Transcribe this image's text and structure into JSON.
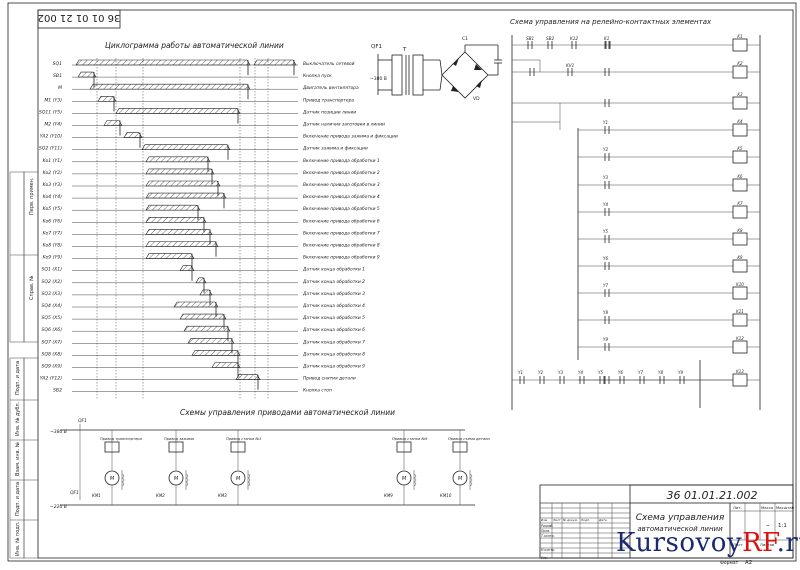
{
  "sheet": {
    "code_top": "36 01 01 21 002",
    "code_stamp": "36 01.01.21.002",
    "title_stamp_1": "Схема управления",
    "title_stamp_2": "автоматической линии",
    "watermark_a": "Kursovoy",
    "watermark_b": "RF",
    "watermark_c": ".ru",
    "format_label": "Формат",
    "format_value": "A2"
  },
  "cyclogram": {
    "title": "Циклограмма работы автоматической линии",
    "rows": [
      {
        "code": "SQ1",
        "label": "Выключатель сетевой"
      },
      {
        "code": "SB1",
        "label": "Кнопка пуск"
      },
      {
        "code": "M",
        "label": "Двигатель вентилятора"
      },
      {
        "code": "M1 (Y3)",
        "label": "Привод транспортера"
      },
      {
        "code": "SQ11 (Y5)",
        "label": "Датчик позиции линии"
      },
      {
        "code": "M2 (Y4)",
        "label": "Датчик наличия заготовки в линии"
      },
      {
        "code": "YA2 (Y10)",
        "label": "Включение привода зажима и фиксации"
      },
      {
        "code": "SQ2 (Y11)",
        "label": "Датчик зажима и фиксации"
      },
      {
        "code": "Ko1 (Y1)",
        "label": "Включение привода обработки 1"
      },
      {
        "code": "Ko2 (Y2)",
        "label": "Включение привода обработки 2"
      },
      {
        "code": "Ko3 (Y3)",
        "label": "Включение привода обработки 3"
      },
      {
        "code": "Ko4 (Y4)",
        "label": "Включение привода обработки 4"
      },
      {
        "code": "Ko5 (Y5)",
        "label": "Включение привода обработки 5"
      },
      {
        "code": "Ko6 (Y6)",
        "label": "Включение привода обработки 6"
      },
      {
        "code": "Ko7 (Y7)",
        "label": "Включение привода обработки 7"
      },
      {
        "code": "Ko8 (Y8)",
        "label": "Включение привода обработки 8"
      },
      {
        "code": "Ko9 (Y9)",
        "label": "Включение привода обработки 9"
      },
      {
        "code": "SQ1 (X1)",
        "label": "Датчик конца обработки 1"
      },
      {
        "code": "SQ2 (X2)",
        "label": "Датчик конца обработки 2"
      },
      {
        "code": "SQ3 (X3)",
        "label": "Датчик конца обработки 3"
      },
      {
        "code": "SQ4 (X4)",
        "label": "Датчик конца обработки 4"
      },
      {
        "code": "SQ5 (X5)",
        "label": "Датчик конца обработки 5"
      },
      {
        "code": "SQ6 (X6)",
        "label": "Датчик конца обработки 6"
      },
      {
        "code": "SQ7 (X7)",
        "label": "Датчик конца обработки 7"
      },
      {
        "code": "SQ8 (X8)",
        "label": "Датчик конца обработки 8"
      },
      {
        "code": "SQ9 (X9)",
        "label": "Датчик конца обработки 9"
      },
      {
        "code": "YA2 (Y12)",
        "label": "Привод снятия детали"
      },
      {
        "code": "SB2",
        "label": "Кнопка стоп"
      }
    ]
  },
  "relay_scheme": {
    "title": "Схема управления на релейно-контактных элементах",
    "relays": [
      "K1",
      "K2",
      "K3",
      "K4",
      "K5",
      "K6",
      "K7",
      "K8",
      "K9",
      "K10",
      "K11",
      "K12",
      "K13"
    ],
    "contacts": [
      "SB1",
      "SB2",
      "K12",
      "K1",
      "KV1",
      "Y1",
      "Y2",
      "Y3",
      "Y4",
      "Y5",
      "Y6",
      "Y7",
      "Y8",
      "Y9"
    ]
  },
  "power_scheme": {
    "title": "Схемы управления приводами автоматической линии",
    "labels": {
      "qf1": "QF1",
      "tr": "T",
      "vd": "VD",
      "c1": "C1",
      "bus_top": "~380 В",
      "bus_bottom": "~220 В"
    },
    "drives": [
      {
        "name": "Привод транспортера",
        "motor": "М",
        "contact": "КМ1"
      },
      {
        "name": "Привод зажима",
        "motor": "М",
        "contact": "КМ2"
      },
      {
        "name": "Привод станка №1",
        "motor": "М",
        "contact": "КМ3"
      },
      {
        "name": "Привод станка №9",
        "motor": "М",
        "contact": "КМ9"
      },
      {
        "name": "Привод съема детали",
        "motor": "М",
        "contact": "КМ10"
      }
    ]
  },
  "stamp": {
    "headers": [
      "Изм.",
      "Лист",
      "№ докум.",
      "Подп.",
      "Дата"
    ],
    "roles": [
      "Разраб.",
      "Пров.",
      "Т.контр.",
      "Н.контр.",
      "Утв."
    ],
    "cols": [
      "Лит.",
      "Масса",
      "Масштаб"
    ],
    "sheet_label": "Лист",
    "sheets_label": "Листов",
    "dash": "–",
    "scale": "1:1"
  },
  "side_labels": [
    "Перв. примен.",
    "Справ. №",
    "Подп. и дата",
    "Инв. № дубл.",
    "Взам. инв. №",
    "Подп. и дата",
    "Инв. № подл."
  ]
}
